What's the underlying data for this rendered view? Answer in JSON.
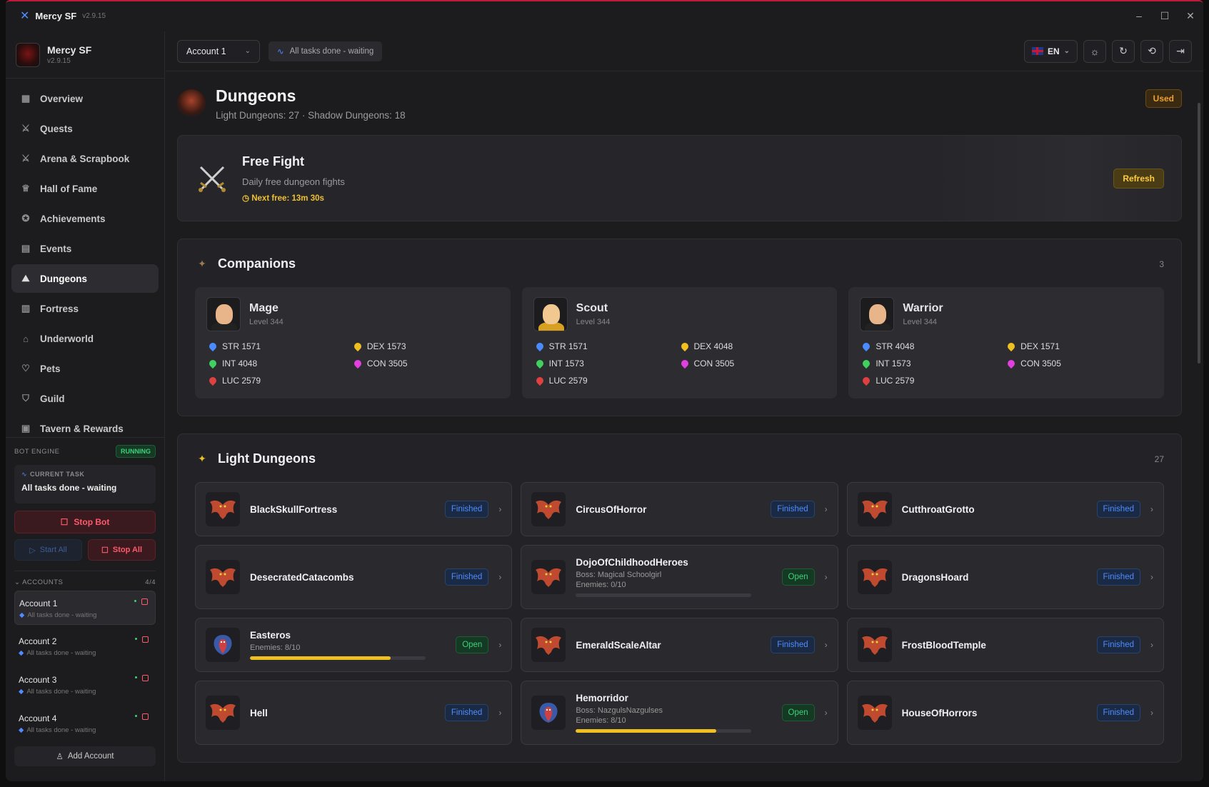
{
  "window": {
    "app_name": "Mercy SF",
    "version": "v2.9.15",
    "controls": [
      "–",
      "☐",
      "✕"
    ]
  },
  "sidebar": {
    "brand_name": "Mercy SF",
    "brand_version": "v2.9.15",
    "nav": [
      {
        "label": "Overview",
        "icon": "grid-icon",
        "glyph": "▦"
      },
      {
        "label": "Quests",
        "icon": "swords-icon",
        "glyph": "⚔"
      },
      {
        "label": "Arena & Scrapbook",
        "icon": "swords-icon",
        "glyph": "⚔"
      },
      {
        "label": "Hall of Fame",
        "icon": "trophy-icon",
        "glyph": "♕"
      },
      {
        "label": "Achievements",
        "icon": "award-icon",
        "glyph": "✪"
      },
      {
        "label": "Events",
        "icon": "calendar-icon",
        "glyph": "▤"
      },
      {
        "label": "Dungeons",
        "icon": "mountain-icon",
        "glyph": "⛰"
      },
      {
        "label": "Fortress",
        "icon": "fortress-icon",
        "glyph": "▥"
      },
      {
        "label": "Underworld",
        "icon": "home-icon",
        "glyph": "⌂"
      },
      {
        "label": "Pets",
        "icon": "cat-icon",
        "glyph": "♡"
      },
      {
        "label": "Guild",
        "icon": "shield-icon",
        "glyph": "⛉"
      },
      {
        "label": "Tavern & Rewards",
        "icon": "gift-icon",
        "glyph": "▣"
      }
    ],
    "active_nav": "Dungeons",
    "engine": {
      "label": "BOT ENGINE",
      "status": "RUNNING",
      "current_task_label": "CURRENT TASK",
      "current_task": "All tasks done - waiting",
      "stop_bot": "Stop Bot",
      "start_all": "Start All",
      "stop_all": "Stop All"
    },
    "accounts_label": "ACCOUNTS",
    "accounts_count": "4/4",
    "accounts": [
      {
        "name": "Account 1",
        "status": "All tasks done - waiting",
        "active": true
      },
      {
        "name": "Account 2",
        "status": "All tasks done - waiting",
        "active": false
      },
      {
        "name": "Account 3",
        "status": "All tasks done - waiting",
        "active": false
      },
      {
        "name": "Account 4",
        "status": "All tasks done - waiting",
        "active": false
      }
    ],
    "add_account": "Add Account"
  },
  "topbar": {
    "account_select": "Account 1",
    "status": "All tasks done - waiting",
    "language": "EN"
  },
  "page": {
    "title": "Dungeons",
    "subtitle": "Light Dungeons: 27 · Shadow Dungeons: 18",
    "badge": "Used"
  },
  "free_fight": {
    "title": "Free Fight",
    "subtitle": "Daily free dungeon fights",
    "next_free": "Next free: 13m 30s",
    "refresh": "Refresh"
  },
  "companions": {
    "title": "Companions",
    "count": "3",
    "items": [
      {
        "name": "Mage",
        "level": "Level 344",
        "portrait": "mage",
        "stats": [
          {
            "label": "STR 1571",
            "color": "blue"
          },
          {
            "label": "DEX 1573",
            "color": "yel"
          },
          {
            "label": "INT 4048",
            "color": "green"
          },
          {
            "label": "CON 3505",
            "color": "pink"
          },
          {
            "label": "LUC 2579",
            "color": "red"
          }
        ]
      },
      {
        "name": "Scout",
        "level": "Level 344",
        "portrait": "scout",
        "stats": [
          {
            "label": "STR 1571",
            "color": "blue"
          },
          {
            "label": "DEX 4048",
            "color": "yel"
          },
          {
            "label": "INT 1573",
            "color": "green"
          },
          {
            "label": "CON 3505",
            "color": "pink"
          },
          {
            "label": "LUC 2579",
            "color": "red"
          }
        ]
      },
      {
        "name": "Warrior",
        "level": "Level 344",
        "portrait": "warrior",
        "stats": [
          {
            "label": "STR 4048",
            "color": "blue"
          },
          {
            "label": "DEX 1571",
            "color": "yel"
          },
          {
            "label": "INT 1573",
            "color": "green"
          },
          {
            "label": "CON 3505",
            "color": "pink"
          },
          {
            "label": "LUC 2579",
            "color": "red"
          }
        ]
      }
    ]
  },
  "light_dungeons": {
    "title": "Light Dungeons",
    "count": "27",
    "items": [
      {
        "name": "BlackSkullFortress",
        "status": "Finished",
        "icon": "bat"
      },
      {
        "name": "CircusOfHorror",
        "status": "Finished",
        "icon": "bat"
      },
      {
        "name": "CutthroatGrotto",
        "status": "Finished",
        "icon": "bat"
      },
      {
        "name": "DesecratedCatacombs",
        "status": "Finished",
        "icon": "bat"
      },
      {
        "name": "DojoOfChildhoodHeroes",
        "status": "Open",
        "icon": "bat",
        "boss": "Boss: Magical Schoolgirl",
        "enemies": "Enemies: 0/10",
        "progress": 0
      },
      {
        "name": "DragonsHoard",
        "status": "Finished",
        "icon": "bat"
      },
      {
        "name": "Easteros",
        "status": "Open",
        "icon": "cobra",
        "enemies": "Enemies: 8/10",
        "progress": 0.8
      },
      {
        "name": "EmeraldScaleAltar",
        "status": "Finished",
        "icon": "bat"
      },
      {
        "name": "FrostBloodTemple",
        "status": "Finished",
        "icon": "bat"
      },
      {
        "name": "Hell",
        "status": "Finished",
        "icon": "bat"
      },
      {
        "name": "Hemorridor",
        "status": "Open",
        "icon": "cobra",
        "boss": "Boss: NazgulsNazgulses",
        "enemies": "Enemies: 8/10",
        "progress": 0.8
      },
      {
        "name": "HouseOfHorrors",
        "status": "Finished",
        "icon": "bat"
      }
    ]
  }
}
